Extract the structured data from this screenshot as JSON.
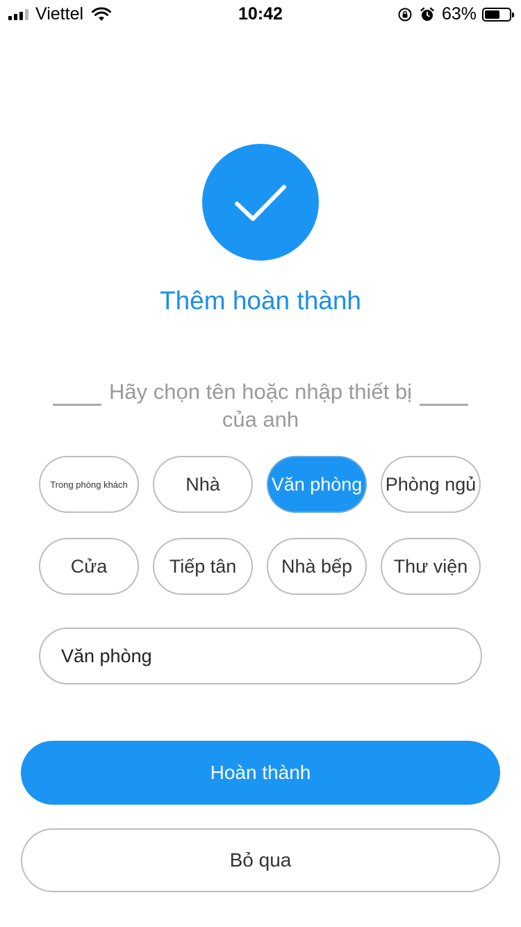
{
  "status_bar": {
    "carrier": "Viettel",
    "time": "10:42",
    "battery_percent_text": "63%",
    "battery_level": 0.63
  },
  "success": {
    "icon": "check-icon",
    "title": "Thêm hoàn thành",
    "accent_color": "#1b95f3"
  },
  "prompt": {
    "text": "Hãy chọn tên hoặc nhập thiết bị của anh"
  },
  "chips": [
    {
      "label": "Trong phòng khách",
      "selected": false
    },
    {
      "label": "Nhà",
      "selected": false
    },
    {
      "label": "Văn phòng",
      "selected": true
    },
    {
      "label": "Phòng ngủ",
      "selected": false
    },
    {
      "label": "Cửa",
      "selected": false
    },
    {
      "label": "Tiếp tân",
      "selected": false
    },
    {
      "label": "Nhà bếp",
      "selected": false
    },
    {
      "label": "Thư viện",
      "selected": false
    }
  ],
  "name_input": {
    "value": "Văn phòng"
  },
  "actions": {
    "done_label": "Hoàn thành",
    "skip_label": "Bỏ qua"
  }
}
